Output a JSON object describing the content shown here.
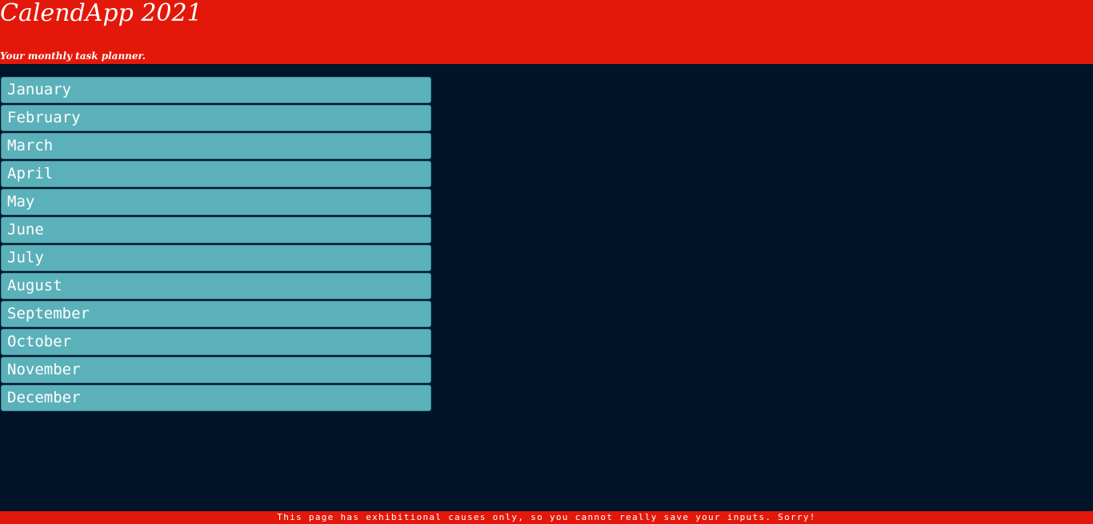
{
  "header": {
    "title": "CalendApp 2021",
    "subtitle": "Your monthly task planner."
  },
  "months": [
    {
      "label": "January"
    },
    {
      "label": "February"
    },
    {
      "label": "March"
    },
    {
      "label": "April"
    },
    {
      "label": "May"
    },
    {
      "label": "June"
    },
    {
      "label": "July"
    },
    {
      "label": "August"
    },
    {
      "label": "September"
    },
    {
      "label": "October"
    },
    {
      "label": "November"
    },
    {
      "label": "December"
    }
  ],
  "footer": {
    "notice": "This page has exhibitional causes only, so you cannot really save your inputs. Sorry!"
  },
  "colors": {
    "header_bg": "#e3180a",
    "page_bg": "#00142a",
    "month_button_bg": "#5bb1ba",
    "text": "#ffffff"
  }
}
